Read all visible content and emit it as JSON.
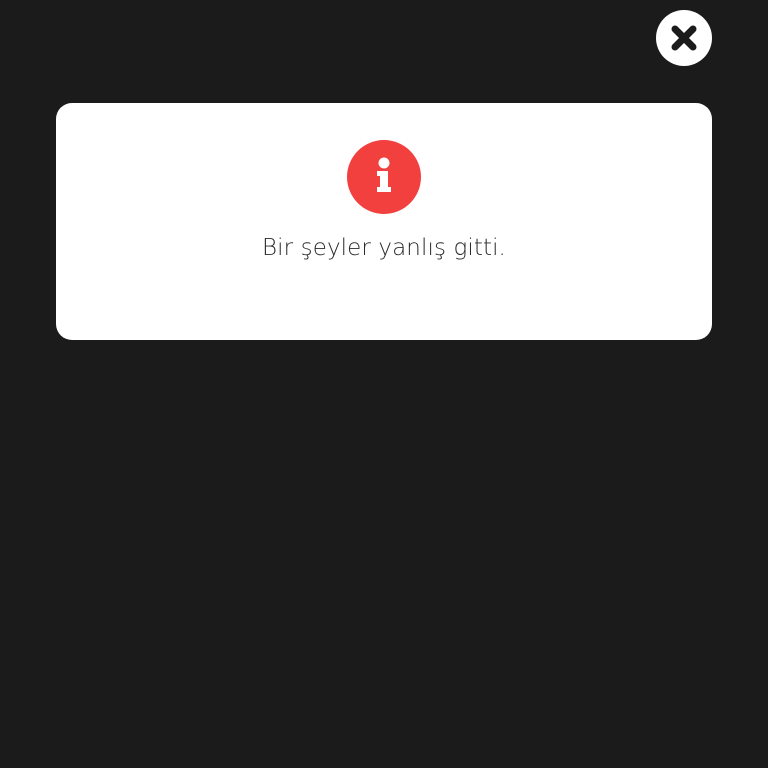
{
  "dialog": {
    "message": "Bir şeyler yanlış gitti.",
    "icon": "info-icon",
    "icon_color": "#f2403f",
    "close_icon": "close-icon",
    "overlay_color": "#1b1b1b",
    "card_color": "#ffffff"
  }
}
